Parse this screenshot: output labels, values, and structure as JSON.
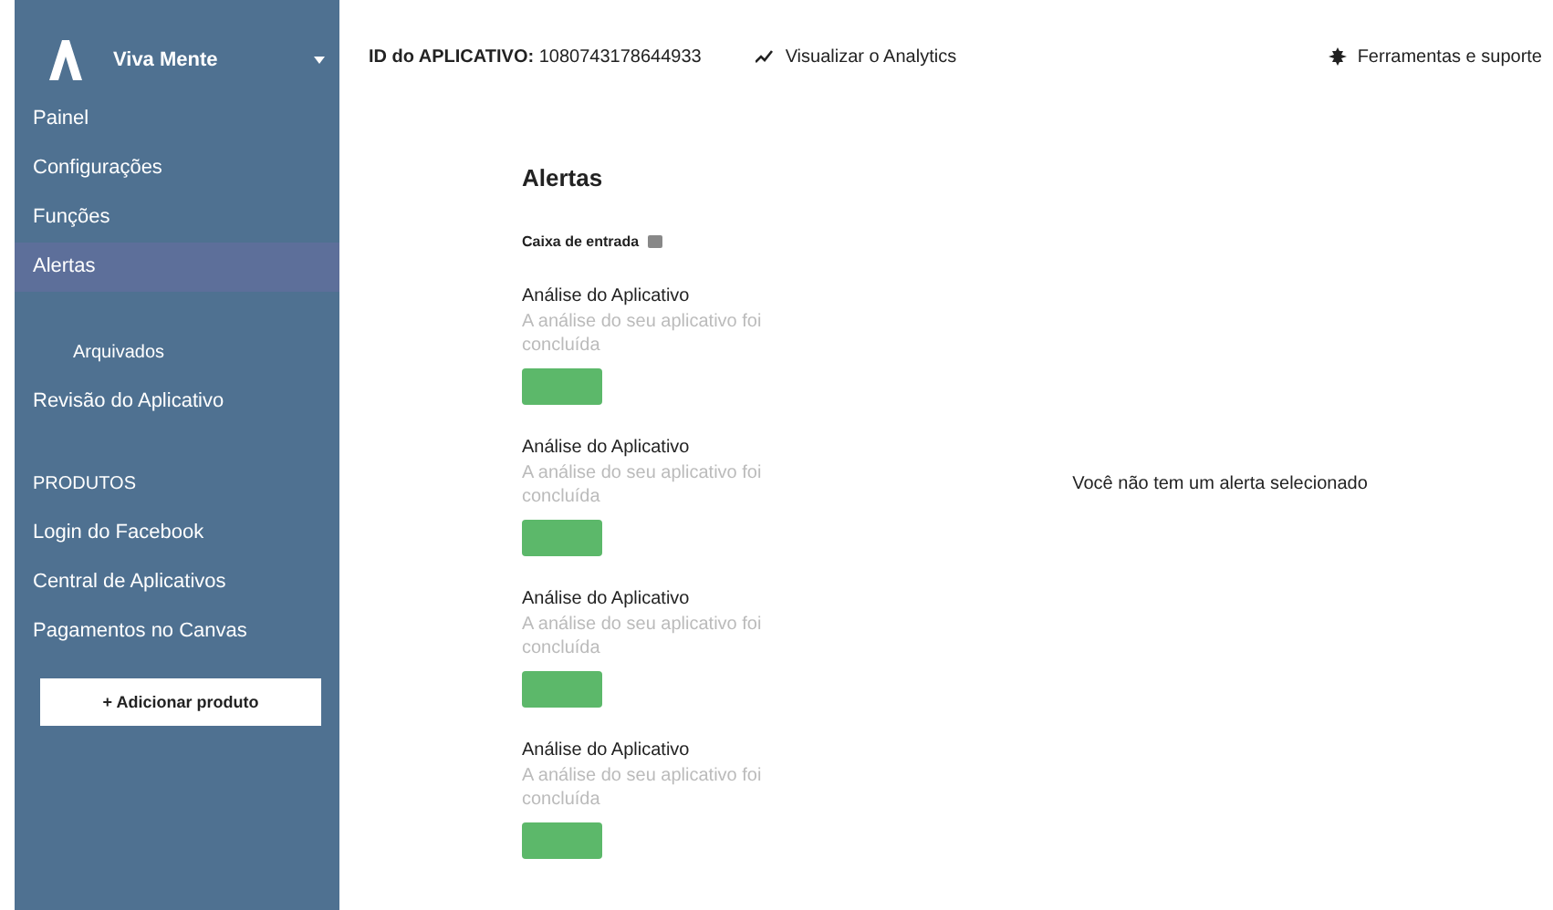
{
  "sidebar": {
    "app_name": "Viva Mente",
    "items": [
      {
        "label": "Painel",
        "selected": false,
        "kind": "item"
      },
      {
        "label": "Configurações",
        "selected": false,
        "kind": "item"
      },
      {
        "label": "Funções",
        "selected": false,
        "kind": "item"
      },
      {
        "label": "Alertas",
        "selected": true,
        "kind": "item"
      },
      {
        "label": "Arquivados",
        "selected": false,
        "kind": "subitem"
      },
      {
        "label": "Revisão do Aplicativo",
        "selected": false,
        "kind": "item"
      },
      {
        "label": "PRODUTOS",
        "selected": false,
        "kind": "header"
      },
      {
        "label": "Login do Facebook",
        "selected": false,
        "kind": "item"
      },
      {
        "label": "Central de Aplicativos",
        "selected": false,
        "kind": "item"
      },
      {
        "label": "Pagamentos no Canvas",
        "selected": false,
        "kind": "item"
      }
    ],
    "add_button": "+ Adicionar produto"
  },
  "topbar": {
    "app_id_label": "ID do APLICATIVO:",
    "app_id": "1080743178644933",
    "analytics_link": "Visualizar o Analytics",
    "tools_link": "Ferramentas e suporte"
  },
  "alerts": {
    "title": "Alertas",
    "inbox_label": "Caixa de entrada",
    "items": [
      {
        "title": "Análise do Aplicativo",
        "body": "A análise do seu aplicativo foi concluída"
      },
      {
        "title": "Análise do Aplicativo",
        "body": "A análise do seu aplicativo foi concluída"
      },
      {
        "title": "Análise do Aplicativo",
        "body": "A análise do seu aplicativo foi concluída"
      },
      {
        "title": "Análise do Aplicativo",
        "body": "A análise do seu aplicativo foi concluída"
      }
    ],
    "empty_message": "Você não tem um alerta selecionado"
  }
}
